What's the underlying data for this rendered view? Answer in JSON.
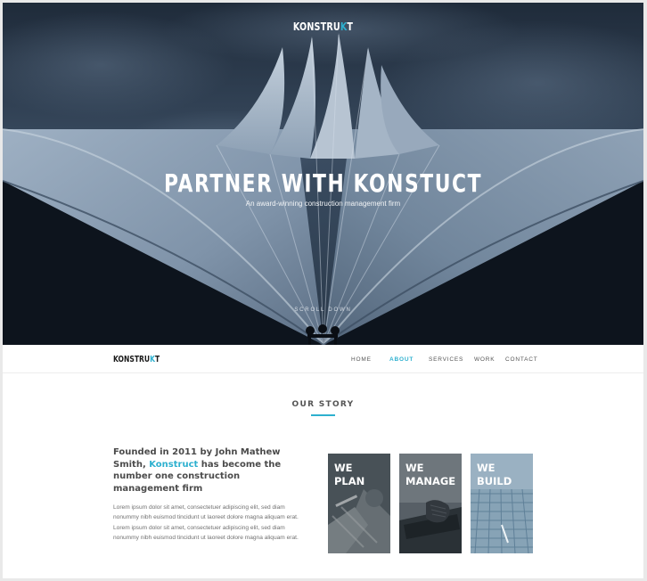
{
  "hero": {
    "logo_text": "KONSTRU",
    "logo_k": "K",
    "logo_end": "T",
    "title": "PARTNER WITH KONSTUCT",
    "subtitle": "An award-winning construction management firm",
    "scroll": "SCROLL DOWN"
  },
  "nav": {
    "logo_text": "KONSTRU",
    "logo_k": "K",
    "logo_end": "T",
    "items": [
      {
        "label": "HOME"
      },
      {
        "label": "ABOUT",
        "active": true
      },
      {
        "label": "SERVICES"
      },
      {
        "label": "WORK"
      },
      {
        "label": "CONTACT"
      }
    ]
  },
  "story": {
    "title": "OUR STORY",
    "lead_before": "Founded in 2011 by John Mathew Smith, ",
    "lead_highlight": "Konstruct",
    "lead_after": " has become the number one construction management firm",
    "body": "Lorem ipsum dolor sit amet, consectetuer adipiscing elit, sed diam nonummy nibh euismod tincidunt ut laoreet dolore magna aliquam erat. Lorem ipsum dolor sit amet, consectetuer adipiscing elit, sed diam nonummy nibh euismod tincidunt ut laoreet dolore magna aliquam erat.",
    "cards": [
      {
        "label": "WE\nPLAN"
      },
      {
        "label": "WE\nMANAGE"
      },
      {
        "label": "WE\nBUILD"
      }
    ]
  },
  "colors": {
    "accent": "#2db0cf",
    "hero_sky": "#34465a",
    "text_dark": "#4b4b4b"
  }
}
